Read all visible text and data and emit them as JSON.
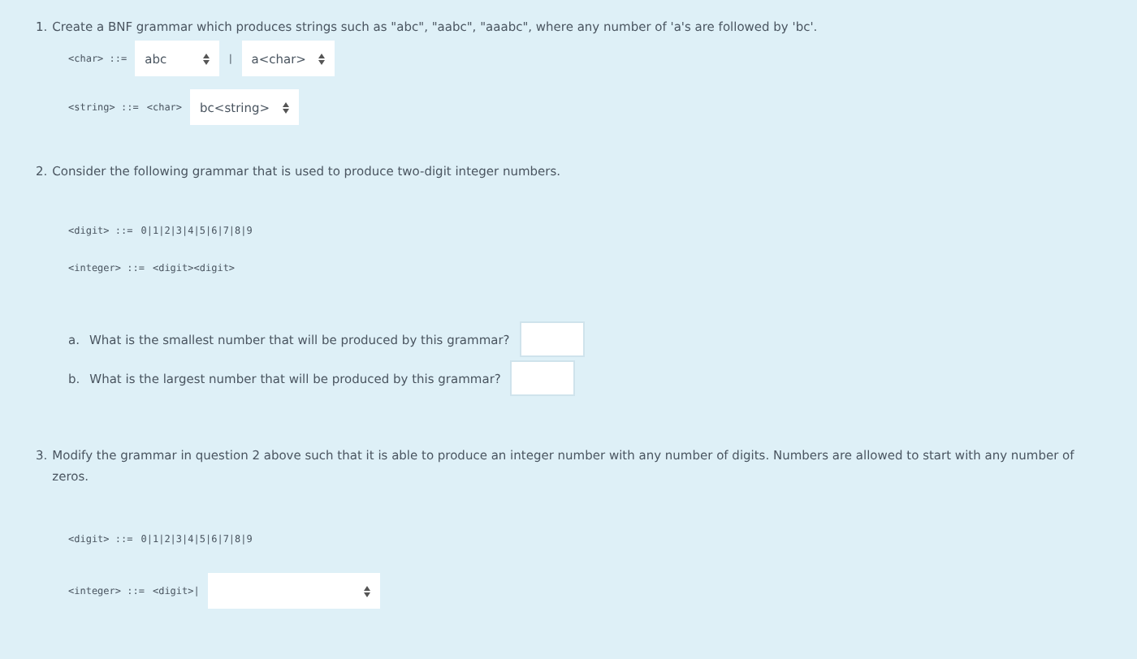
{
  "questions": [
    {
      "number": "1.",
      "text": "Create a BNF grammar which produces strings such as \"abc\", \"aabc\", \"aaabc\", where any number of 'a's are followed by 'bc'.",
      "grammar": [
        {
          "lhs": "<char> ::=",
          "items": [
            {
              "kind": "select",
              "value": "abc"
            },
            {
              "kind": "text",
              "text": "|"
            },
            {
              "kind": "select",
              "value": "a<char>"
            }
          ]
        },
        {
          "lhs": "<string> ::=",
          "items": [
            {
              "kind": "text",
              "text": "<char>"
            },
            {
              "kind": "select",
              "value": "bc<string>"
            }
          ]
        }
      ]
    },
    {
      "number": "2.",
      "text": "Consider the following grammar that is used to produce two-digit integer numbers.",
      "grammar": [
        {
          "lhs": "<digit> ::=",
          "items": [
            {
              "kind": "text",
              "text": "0|1|2|3|4|5|6|7|8|9"
            }
          ]
        },
        {
          "lhs": "<integer> ::=",
          "items": [
            {
              "kind": "text",
              "text": "<digit><digit>"
            }
          ]
        }
      ],
      "parts": [
        {
          "letter": "a.",
          "text": "What is the smallest number that will be produced by this grammar?"
        },
        {
          "letter": "b.",
          "text": "What is the largest number that will be produced by this grammar?"
        }
      ]
    },
    {
      "number": "3.",
      "text": "Modify the grammar in question 2 above such that it is able to produce an integer number with any number of digits. Numbers are allowed to start with any number of zeros.",
      "grammar": [
        {
          "lhs": "<digit> ::=",
          "items": [
            {
              "kind": "text",
              "text": "0|1|2|3|4|5|6|7|8|9"
            }
          ]
        },
        {
          "lhs": "<integer> ::=",
          "items": [
            {
              "kind": "text",
              "text": "<digit>|"
            },
            {
              "kind": "select"
            }
          ]
        }
      ]
    }
  ]
}
